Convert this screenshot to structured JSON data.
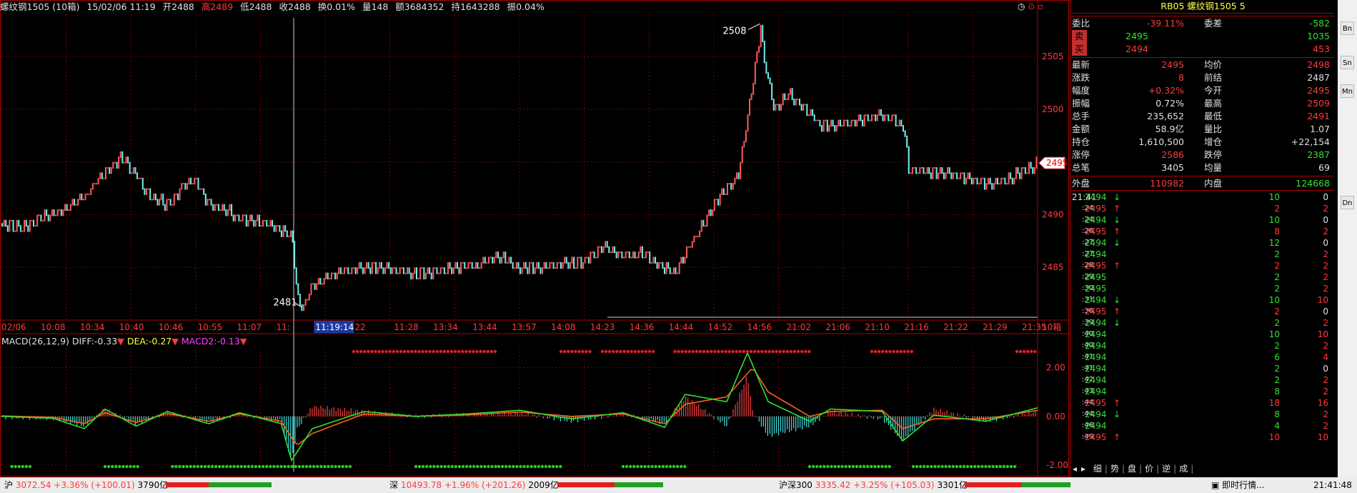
{
  "header": {
    "name": "螺纹钢1505 (10箱)",
    "datetime": "15/02/06 11:19",
    "open": "开2488",
    "high": "高2489",
    "low": "低2488",
    "close": "收2488",
    "turnover_rate": "换0.01%",
    "volume": "量148",
    "amount": "额3684352",
    "position": "持1643288",
    "amplitude": "振0.04%"
  },
  "chart_data": {
    "type": "line",
    "series": [],
    "price_axis": {
      "ticks": [
        2485,
        2490,
        2495,
        2500,
        2505
      ],
      "ylim": [
        2480,
        2509
      ]
    },
    "price_path": [
      [
        0,
        2489.2
      ],
      [
        0.02,
        2488.8
      ],
      [
        0.04,
        2489.9
      ],
      [
        0.06,
        2490.5
      ],
      [
        0.08,
        2491.8
      ],
      [
        0.09,
        2493.1
      ],
      [
        0.1,
        2494
      ],
      [
        0.115,
        2495.5
      ],
      [
        0.13,
        2493.8
      ],
      [
        0.14,
        2492
      ],
      [
        0.16,
        2491
      ],
      [
        0.175,
        2492.8
      ],
      [
        0.185,
        2493.5
      ],
      [
        0.2,
        2491
      ],
      [
        0.215,
        2490.6
      ],
      [
        0.23,
        2489.7
      ],
      [
        0.26,
        2489.1
      ],
      [
        0.28,
        2488
      ],
      [
        0.285,
        2482
      ],
      [
        0.29,
        2481.2
      ],
      [
        0.3,
        2483.5
      ],
      [
        0.33,
        2484.8
      ],
      [
        0.36,
        2485.1
      ],
      [
        0.4,
        2484.5
      ],
      [
        0.43,
        2484.9
      ],
      [
        0.46,
        2485.3
      ],
      [
        0.48,
        2486.2
      ],
      [
        0.5,
        2484.9
      ],
      [
        0.53,
        2485.2
      ],
      [
        0.56,
        2485.6
      ],
      [
        0.58,
        2487
      ],
      [
        0.6,
        2486.1
      ],
      [
        0.62,
        2486.5
      ],
      [
        0.63,
        2485.4
      ],
      [
        0.65,
        2484.6
      ],
      [
        0.67,
        2488.2
      ],
      [
        0.69,
        2491.5
      ],
      [
        0.71,
        2493.7
      ],
      [
        0.72,
        2499.5
      ],
      [
        0.73,
        2506.2
      ],
      [
        0.732,
        2508.1
      ],
      [
        0.735,
        2505
      ],
      [
        0.745,
        2500.1
      ],
      [
        0.76,
        2501.5
      ],
      [
        0.78,
        2499.7
      ],
      [
        0.79,
        2498.5
      ],
      [
        0.82,
        2498.8
      ],
      [
        0.85,
        2499.5
      ],
      [
        0.87,
        2498.6
      ],
      [
        0.875,
        2494.3
      ],
      [
        0.89,
        2494.2
      ],
      [
        0.92,
        2493.8
      ],
      [
        0.95,
        2493
      ],
      [
        0.97,
        2493.4
      ],
      [
        1,
        2494.9
      ]
    ],
    "price_labels": {
      "high": "2508",
      "low": "2481",
      "current": "2495"
    },
    "time_labels": [
      "02/06",
      "10:08",
      "10:34",
      "10:40",
      "10:46",
      "10:55",
      "11:07",
      "11:",
      "11:19:14",
      "22",
      "11:28",
      "13:34",
      "13:44",
      "13:57",
      "14:08",
      "14:23",
      "14:36",
      "14:44",
      "14:52",
      "14:56",
      "21:02",
      "21:06",
      "21:10",
      "21:16",
      "21:22",
      "21:29",
      "21:35",
      "10箱"
    ],
    "macd": {
      "title": "MACD(26,12,9)",
      "diff_label": "DIFF:-0.33",
      "dea_label": "DEA:-0.27",
      "macd_label": "MACD2:-0.13",
      "ticks": [
        "2.00",
        "0.00",
        "-2.00"
      ],
      "ylim": [
        -2.2,
        2.8
      ],
      "diff_path": [
        [
          0,
          0
        ],
        [
          0.05,
          -0.08
        ],
        [
          0.08,
          -0.5
        ],
        [
          0.1,
          0.3
        ],
        [
          0.13,
          -0.4
        ],
        [
          0.16,
          0.2
        ],
        [
          0.2,
          -0.3
        ],
        [
          0.23,
          0.15
        ],
        [
          0.27,
          -0.3
        ],
        [
          0.28,
          -1.8
        ],
        [
          0.3,
          -0.5
        ],
        [
          0.35,
          0.2
        ],
        [
          0.4,
          0
        ],
        [
          0.45,
          0.1
        ],
        [
          0.5,
          0.25
        ],
        [
          0.55,
          -0.1
        ],
        [
          0.6,
          0.15
        ],
        [
          0.64,
          -0.45
        ],
        [
          0.66,
          0.9
        ],
        [
          0.7,
          0.6
        ],
        [
          0.72,
          2.6
        ],
        [
          0.74,
          0.6
        ],
        [
          0.78,
          -0.2
        ],
        [
          0.8,
          0.3
        ],
        [
          0.85,
          0.2
        ],
        [
          0.87,
          -1.0
        ],
        [
          0.9,
          0.05
        ],
        [
          0.95,
          -0.2
        ],
        [
          1,
          0.35
        ]
      ],
      "dea_path": [
        [
          0,
          0.02
        ],
        [
          0.05,
          -0.04
        ],
        [
          0.08,
          -0.3
        ],
        [
          0.1,
          0.15
        ],
        [
          0.13,
          -0.25
        ],
        [
          0.16,
          0.12
        ],
        [
          0.2,
          -0.2
        ],
        [
          0.23,
          0.1
        ],
        [
          0.27,
          -0.2
        ],
        [
          0.285,
          -1.2
        ],
        [
          0.3,
          -0.7
        ],
        [
          0.35,
          0.1
        ],
        [
          0.4,
          0
        ],
        [
          0.45,
          0.06
        ],
        [
          0.5,
          0.18
        ],
        [
          0.55,
          0
        ],
        [
          0.6,
          0.1
        ],
        [
          0.64,
          -0.3
        ],
        [
          0.66,
          0.5
        ],
        [
          0.7,
          0.8
        ],
        [
          0.725,
          2.0
        ],
        [
          0.74,
          1.0
        ],
        [
          0.78,
          0
        ],
        [
          0.8,
          0.2
        ],
        [
          0.85,
          0.25
        ],
        [
          0.87,
          -0.5
        ],
        [
          0.9,
          -0.1
        ],
        [
          0.95,
          -0.1
        ],
        [
          1,
          0.25
        ]
      ]
    }
  },
  "panel": {
    "title": "RB05 螺纹钢1505 5",
    "rows": [
      {
        "label": "委比",
        "v1": "-39.11%",
        "label2": "委差",
        "v2": "-582"
      },
      {
        "label": "卖",
        "v1": "2495",
        "label2": "",
        "v2": "1035"
      },
      {
        "label": "买",
        "v1": "2494",
        "label2": "",
        "v2": "453"
      },
      {
        "label": "最新",
        "v1": "2495",
        "label2": "均价",
        "v2": "2498"
      },
      {
        "label": "涨跌",
        "v1": "8",
        "label2": "前结",
        "v2": "2487"
      },
      {
        "label": "幅度",
        "v1": "+0.32%",
        "label2": "今开",
        "v2": "2495"
      },
      {
        "label": "振幅",
        "v1": "0.72%",
        "label2": "最高",
        "v2": "2509"
      },
      {
        "label": "总手",
        "v1": "235,652",
        "label2": "最低",
        "v2": "2491"
      },
      {
        "label": "金额",
        "v1": "58.9亿",
        "label2": "量比",
        "v2": "1.07"
      },
      {
        "label": "持仓",
        "v1": "1,610,500",
        "label2": "增仓",
        "v2": "+22,154"
      },
      {
        "label": "涨停",
        "v1": "2586",
        "label2": "跌停",
        "v2": "2387"
      },
      {
        "label": "总笔",
        "v1": "3405",
        "label2": "均量",
        "v2": "69"
      },
      {
        "label": "外盘",
        "v1": "110982",
        "label2": "内盘",
        "v2": "124668"
      }
    ],
    "ticks": [
      {
        "t": "21:41",
        "p": "2494",
        "d": "↓",
        "v": "10",
        "c": "0"
      },
      {
        "t": ":24",
        "p": "2495",
        "d": "↑",
        "v": "2",
        "c": "2"
      },
      {
        "t": ":24",
        "p": "2494",
        "d": "↓",
        "v": "10",
        "c": "0"
      },
      {
        "t": ":26",
        "p": "2495",
        "d": "↑",
        "v": "8",
        "c": "2"
      },
      {
        "t": ":27",
        "p": "2494",
        "d": "↓",
        "v": "12",
        "c": "0"
      },
      {
        "t": ":27",
        "p": "2494",
        "d": "",
        "v": "2",
        "c": "2"
      },
      {
        "t": ":28",
        "p": "2495",
        "d": "↑",
        "v": "2",
        "c": "2"
      },
      {
        "t": ":29",
        "p": "2495",
        "d": "",
        "v": "2",
        "c": "2"
      },
      {
        "t": ":30",
        "p": "2495",
        "d": "",
        "v": "2",
        "c": "2"
      },
      {
        "t": ":31",
        "p": "2494",
        "d": "↓",
        "v": "10",
        "c": "10"
      },
      {
        "t": ":36",
        "p": "2495",
        "d": "↑",
        "v": "2",
        "c": "0"
      },
      {
        "t": ":39",
        "p": "2494",
        "d": "↓",
        "v": "2",
        "c": "2"
      },
      {
        "t": ":40",
        "p": "2494",
        "d": "",
        "v": "10",
        "c": "10"
      },
      {
        "t": ":40",
        "p": "2494",
        "d": "",
        "v": "2",
        "c": "2"
      },
      {
        "t": ":41",
        "p": "2494",
        "d": "",
        "v": "6",
        "c": "4"
      },
      {
        "t": ":41",
        "p": "2494",
        "d": "",
        "v": "2",
        "c": "0"
      },
      {
        "t": ":42",
        "p": "2494",
        "d": "",
        "v": "2",
        "c": "2"
      },
      {
        "t": ":43",
        "p": "2494",
        "d": "",
        "v": "8",
        "c": "2"
      },
      {
        "t": ":44",
        "p": "2495",
        "d": "↑",
        "v": "18",
        "c": "16"
      },
      {
        "t": ":44",
        "p": "2494",
        "d": "↓",
        "v": "8",
        "c": "2"
      },
      {
        "t": ":46",
        "p": "2494",
        "d": "",
        "v": "4",
        "c": "2"
      },
      {
        "t": ":49",
        "p": "2495",
        "d": "↑",
        "v": "10",
        "c": "10"
      }
    ],
    "tabs": [
      "细",
      "势",
      "盘",
      "价",
      "逆",
      "成"
    ]
  },
  "toolbar": {
    "items": [
      "Bn",
      "Sn",
      "Mn",
      "Dn"
    ]
  },
  "status": {
    "sh": {
      "name": "沪",
      "value": "3072.54",
      "pct": "+3.36%",
      "chg": "(+100.01)",
      "amt": "3790亿"
    },
    "sz": {
      "name": "深",
      "value": "10493.78",
      "pct": "+1.96%",
      "chg": "(+201.26)",
      "amt": "2009亿"
    },
    "hs": {
      "name": "沪深300",
      "value": "3335.42",
      "pct": "+3.25%",
      "chg": "(+105.03)",
      "amt": "3301亿"
    },
    "app": "即时行情...",
    "clock": "21:41:48"
  }
}
